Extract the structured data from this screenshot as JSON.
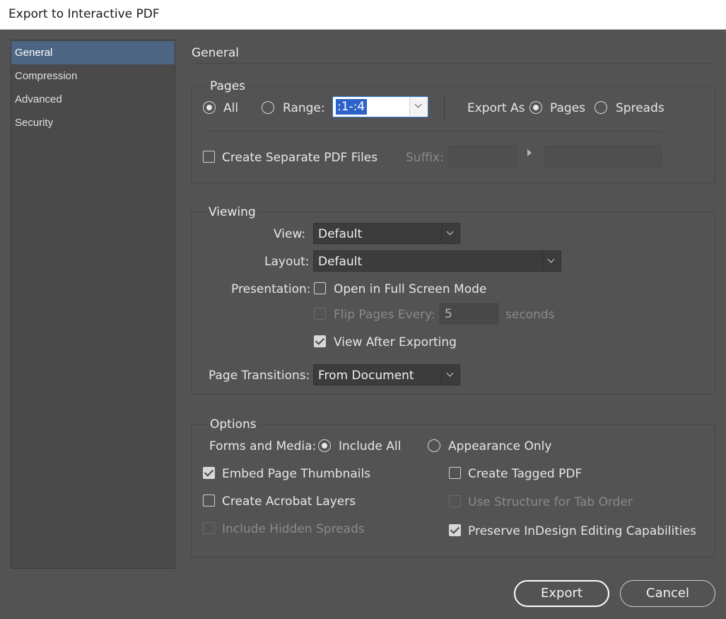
{
  "window": {
    "title": "Export to Interactive PDF"
  },
  "sidebar": {
    "items": [
      {
        "label": "General",
        "active": true
      },
      {
        "label": "Compression",
        "active": false
      },
      {
        "label": "Advanced",
        "active": false
      },
      {
        "label": "Security",
        "active": false
      }
    ]
  },
  "main": {
    "title": "General",
    "pages": {
      "heading": "Pages",
      "all_label": "All",
      "all_selected": true,
      "range_label": "Range:",
      "range_value": ":1-:4",
      "export_as_label": "Export As",
      "pages_label": "Pages",
      "pages_selected": true,
      "spreads_label": "Spreads",
      "separate_label": "Create Separate PDF Files",
      "separate_checked": false,
      "suffix_label": "Suffix:"
    },
    "viewing": {
      "heading": "Viewing",
      "view_label": "View:",
      "view_value": "Default",
      "layout_label": "Layout:",
      "layout_value": "Default",
      "presentation_label": "Presentation:",
      "fullscreen_label": "Open in Full Screen Mode",
      "fullscreen_checked": false,
      "flip_label": "Flip Pages Every:",
      "flip_value": "5",
      "seconds_label": "seconds",
      "view_after_label": "View After Exporting",
      "view_after_checked": true,
      "transitions_label": "Page Transitions:",
      "transitions_value": "From Document"
    },
    "options": {
      "heading": "Options",
      "forms_label": "Forms and Media:",
      "include_all_label": "Include All",
      "include_all_selected": true,
      "appearance_label": "Appearance Only",
      "thumbnails_label": "Embed Page Thumbnails",
      "thumbnails_checked": true,
      "tagged_label": "Create Tagged PDF",
      "tagged_checked": false,
      "layers_label": "Create Acrobat Layers",
      "layers_checked": false,
      "tab_order_label": "Use Structure for Tab Order",
      "hidden_spreads_label": "Include Hidden Spreads",
      "preserve_label": "Preserve InDesign Editing Capabilities",
      "preserve_checked": true
    }
  },
  "buttons": {
    "export_label": "Export",
    "cancel_label": "Cancel"
  },
  "colors": {
    "background": "#535353",
    "sidebar_active": "#4b6582",
    "range_highlight": "#2d63c8"
  }
}
